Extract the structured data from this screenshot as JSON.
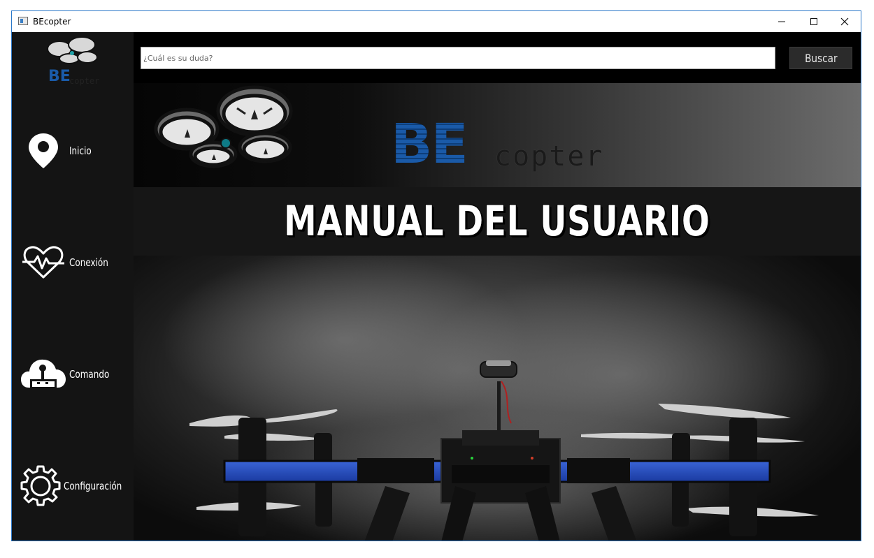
{
  "window": {
    "title": "BEcopter",
    "controls": {
      "minimize": "—",
      "maximize": "☐",
      "close": "✕"
    }
  },
  "sidebar": {
    "logo_text": "BEcopter",
    "items": [
      {
        "label": "Inicio",
        "icon": "location-pin-icon"
      },
      {
        "label": "Conexión",
        "icon": "heartbeat-icon"
      },
      {
        "label": "Comando",
        "icon": "joystick-cloud-icon"
      },
      {
        "label": "Configuración",
        "icon": "gear-icon"
      }
    ]
  },
  "search": {
    "placeholder": "¿Cuál es su duda?",
    "value": "",
    "button_label": "Buscar"
  },
  "banner": {
    "logo_be": "BE",
    "logo_copter": "copter",
    "title": "MANUAL DEL USUARIO"
  },
  "colors": {
    "brand_blue": "#1a5aa8",
    "sidebar_bg": "#141414",
    "window_border": "#2b78c9"
  }
}
